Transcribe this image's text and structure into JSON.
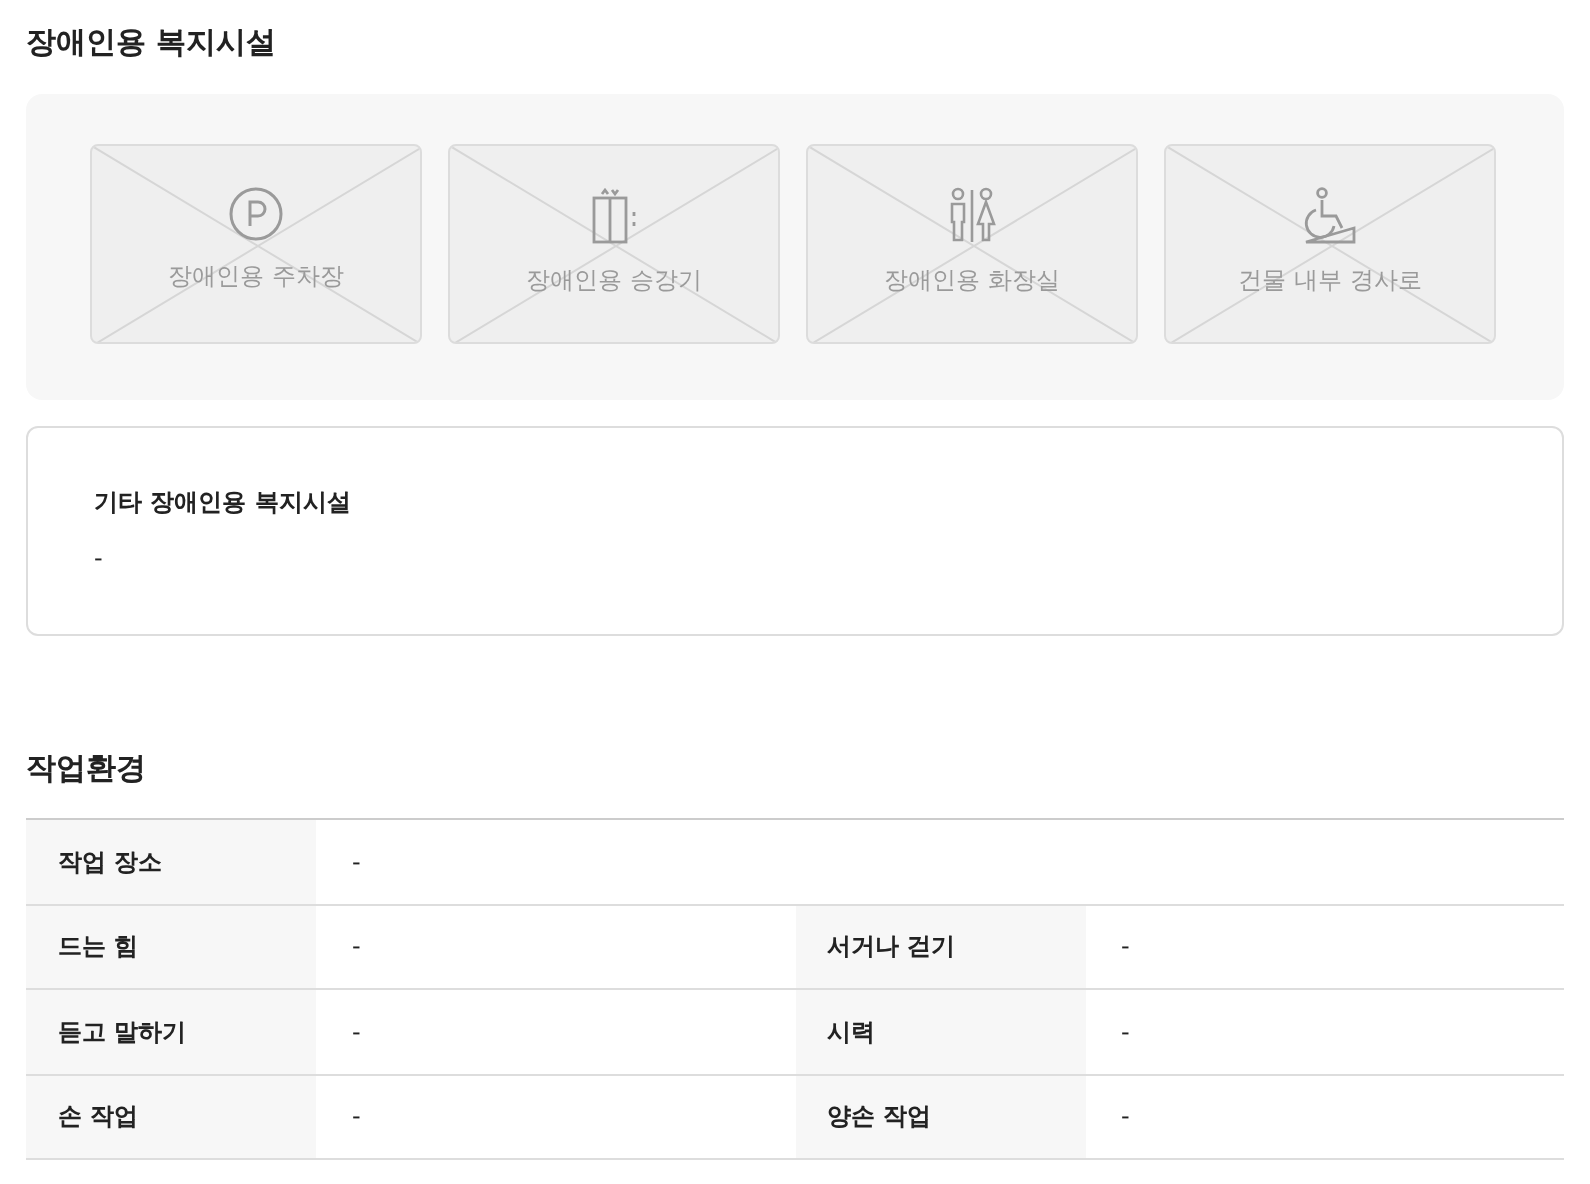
{
  "facilities": {
    "title": "장애인용 복지시설",
    "items": [
      {
        "kind": "parking",
        "label": "장애인용 주차장",
        "available": false
      },
      {
        "kind": "elevator",
        "label": "장애인용 승강기",
        "available": false
      },
      {
        "kind": "restroom",
        "label": "장애인용 화장실",
        "available": false
      },
      {
        "kind": "ramp",
        "label": "건물 내부 경사로",
        "available": false
      }
    ],
    "other": {
      "label": "기타 장애인용 복지시설",
      "value": "-"
    }
  },
  "environment": {
    "title": "작업환경",
    "rows": [
      [
        {
          "label": "작업 장소",
          "value": "-"
        }
      ],
      [
        {
          "label": "드는 힘",
          "value": "-"
        },
        {
          "label": "서거나 걷기",
          "value": "-"
        }
      ],
      [
        {
          "label": "듣고 말하기",
          "value": "-"
        },
        {
          "label": "시력",
          "value": "-"
        }
      ],
      [
        {
          "label": "손 작업",
          "value": "-"
        },
        {
          "label": "양손 작업",
          "value": "-"
        }
      ]
    ]
  }
}
